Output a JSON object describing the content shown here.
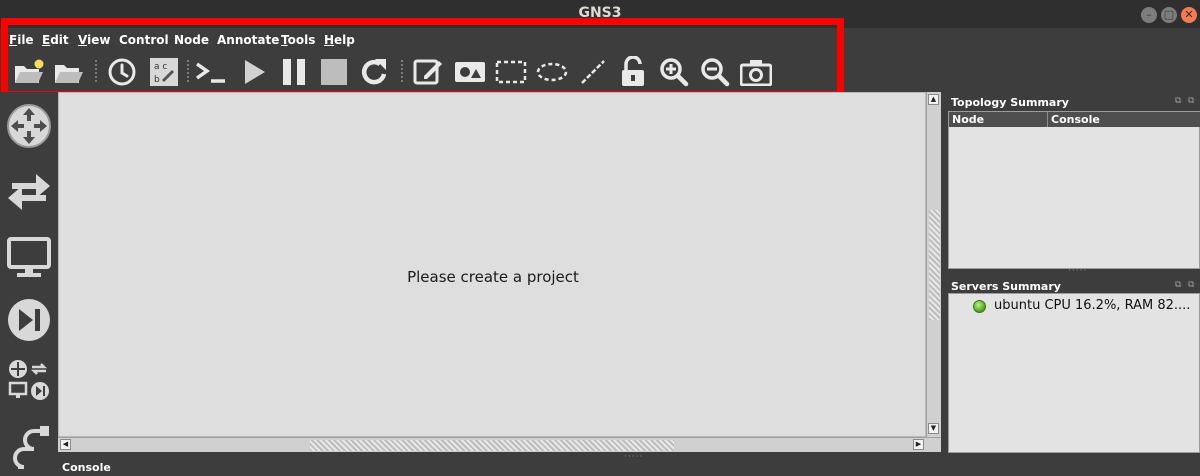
{
  "window": {
    "title": "GNS3"
  },
  "menu": [
    {
      "label_first": "F",
      "label_rest": "ile"
    },
    {
      "label_first": "E",
      "label_rest": "dit"
    },
    {
      "label_first": "V",
      "label_rest": "iew"
    },
    {
      "label_first": "",
      "label_rest": "Control"
    },
    {
      "label_first": "",
      "label_rest": "Node"
    },
    {
      "label_first": "",
      "label_rest": "Annotate"
    },
    {
      "label_first": "T",
      "label_rest": "ools"
    },
    {
      "label_first": "H",
      "label_rest": "elp"
    }
  ],
  "toolbar": {
    "icons": [
      "new-project-icon",
      "open-project-icon",
      "snapshot-icon",
      "show-interface-labels-icon",
      "console-all-icon",
      "start-all-icon",
      "suspend-all-icon",
      "stop-all-icon",
      "reload-all-icon",
      "add-note-icon",
      "insert-picture-icon",
      "draw-rectangle-icon",
      "draw-ellipse-icon",
      "draw-line-icon",
      "unlock-icon",
      "zoom-in-icon",
      "zoom-out-icon",
      "screenshot-icon"
    ]
  },
  "dock": {
    "icons": [
      "routers-icon",
      "switches-icon",
      "end-devices-icon",
      "security-devices-icon",
      "all-devices-icon",
      "add-link-icon"
    ]
  },
  "canvas": {
    "message": "Please create a project"
  },
  "topology": {
    "title": "Topology Summary",
    "columns": [
      "Node",
      "Console"
    ]
  },
  "servers": {
    "title": "Servers Summary",
    "entries": [
      {
        "text": "ubuntu CPU 16.2%, RAM 82....",
        "status": "running"
      }
    ]
  },
  "bottom": {
    "console_label": "Console"
  },
  "colors": {
    "highlight": "#ff0000",
    "chrome": "#3d3d3d",
    "canvas": "#dedede",
    "server_ok": "#4aa019"
  }
}
